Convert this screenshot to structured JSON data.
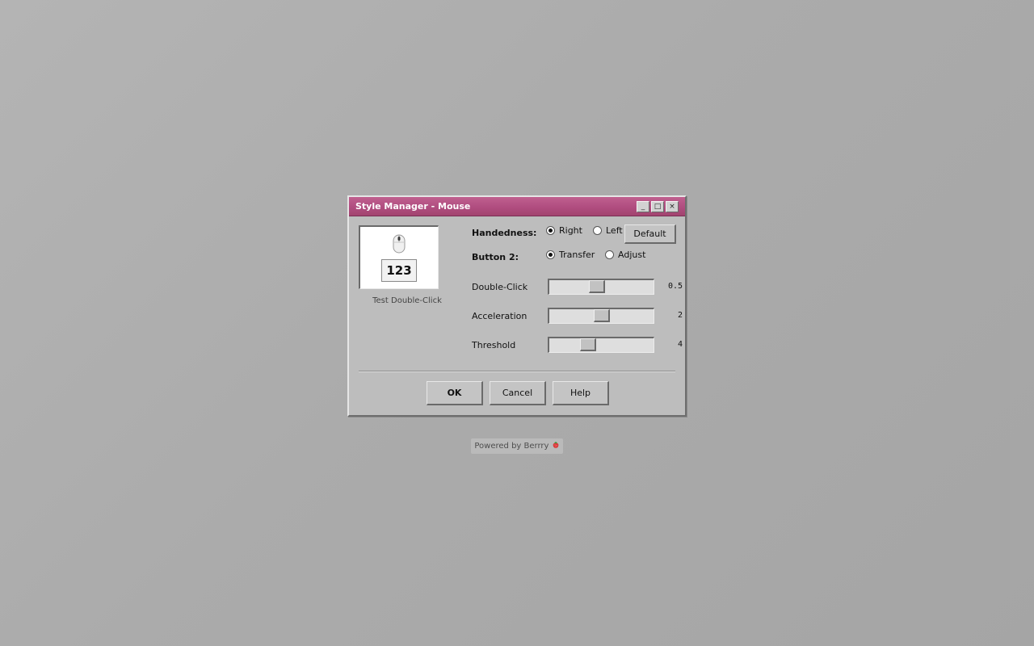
{
  "window": {
    "title": "Style Manager - Mouse",
    "title_bar_color": "#b04d80",
    "minimize_label": "_",
    "maximize_label": "□",
    "close_label": "×"
  },
  "preview": {
    "counter": "123",
    "test_label": "Test Double-Click"
  },
  "handedness": {
    "label": "Handedness:",
    "options": [
      {
        "label": "Right",
        "selected": true
      },
      {
        "label": "Left",
        "selected": false
      }
    ]
  },
  "button2": {
    "label": "Button 2:",
    "options": [
      {
        "label": "Transfer",
        "selected": true
      },
      {
        "label": "Adjust",
        "selected": false
      }
    ]
  },
  "default_button": "Default",
  "sliders": [
    {
      "label": "Double-Click",
      "value": "0.5",
      "level": 0.45
    },
    {
      "label": "Acceleration",
      "value": "2",
      "level": 0.5
    },
    {
      "label": "Threshold",
      "value": "4",
      "level": 0.35
    }
  ],
  "buttons": {
    "ok": "OK",
    "cancel": "Cancel",
    "help": "Help"
  },
  "footer": {
    "text": "Powered by Berrry"
  }
}
